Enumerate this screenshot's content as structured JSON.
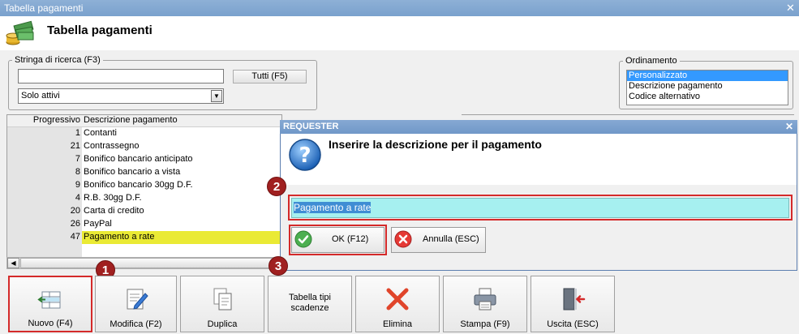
{
  "window": {
    "title": "Tabella pagamenti",
    "close_glyph": "✕"
  },
  "header": {
    "title": "Tabella pagamenti",
    "icon": "money-stack-icon"
  },
  "search": {
    "group_label": "Stringa di ricerca (F3)",
    "value": "",
    "all_button_label": "Tutti (F5)",
    "filter_value": "Solo attivi"
  },
  "order": {
    "group_label": "Ordinamento",
    "items": [
      "Personalizzato",
      "Descrizione pagamento",
      "Codice alternativo"
    ],
    "selected": "Personalizzato"
  },
  "grid": {
    "columns": [
      "Progressivo",
      "Descrizione pagamento"
    ],
    "rows": [
      [
        "1",
        "Contanti"
      ],
      [
        "21",
        "Contrassegno"
      ],
      [
        "7",
        "Bonifico bancario anticipato"
      ],
      [
        "8",
        "Bonifico bancario a vista"
      ],
      [
        "9",
        "Bonifico bancario 30gg D.F."
      ],
      [
        "4",
        "R.B. 30gg D.F."
      ],
      [
        "20",
        "Carta di credito"
      ],
      [
        "26",
        "PayPal"
      ],
      [
        "47",
        "Pagamento a rate"
      ]
    ],
    "selected_row": "Pagamento a rate"
  },
  "dialog": {
    "title": "REQUESTER",
    "prompt": "Inserire la descrizione per il pagamento",
    "input_value": "Pagamento a rate",
    "ok_label": "OK (F12)",
    "cancel_label": "Annulla (ESC)"
  },
  "badges": [
    "1",
    "2",
    "3"
  ],
  "toolbar": {
    "new": "Nuovo (F4)",
    "edit": "Modifica (F2)",
    "duplicate": "Duplica",
    "types_line1": "Tabella tipi",
    "types_line2": "scadenze",
    "delete": "Elimina",
    "print": "Stampa (F9)",
    "exit": "Uscita (ESC)"
  },
  "colors": {
    "selection_yellow": "#eaea34",
    "highlight_red": "#d42a2a",
    "input_cyan": "#a6f0f0",
    "badge": "#a02020"
  }
}
